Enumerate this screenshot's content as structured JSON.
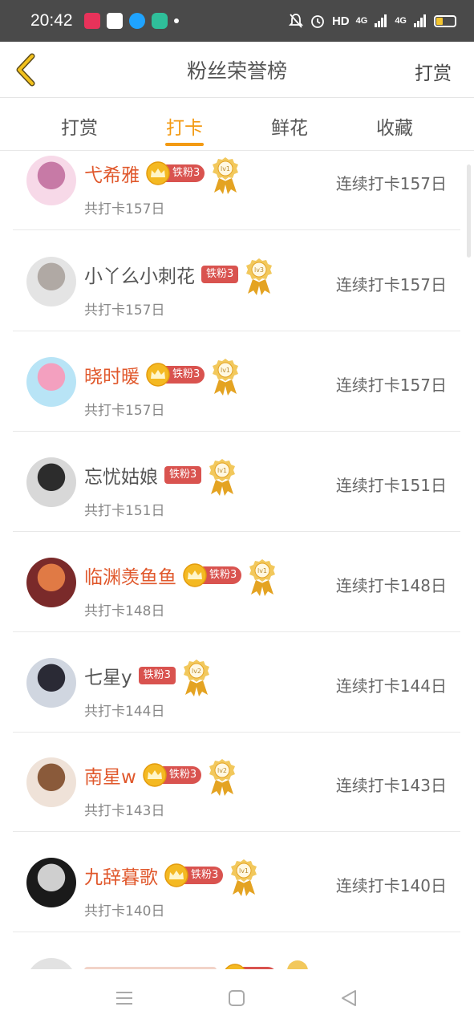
{
  "status_bar": {
    "time": "20:42",
    "network": "HD",
    "signal1": "4G",
    "signal2": "4G"
  },
  "header": {
    "title": "粉丝荣誉榜",
    "right_action": "打赏",
    "back_icon": "chevron-left-icon"
  },
  "tabs": [
    {
      "label": "打赏",
      "active": false
    },
    {
      "label": "打卡",
      "active": true
    },
    {
      "label": "鲜花",
      "active": false
    },
    {
      "label": "收藏",
      "active": false
    }
  ],
  "colors": {
    "accent": "#f39a13",
    "vip_name": "#e0582c",
    "fan_badge": "#d9534f"
  },
  "entries": [
    {
      "name": "弋希雅",
      "vip": true,
      "fan_badge": "铁粉3",
      "level": "lv1",
      "total": "共打卡157日",
      "streak": "连续打卡157日"
    },
    {
      "name": "小丫么小刺花",
      "vip": false,
      "fan_badge": "铁粉3",
      "level": "lv3",
      "total": "共打卡157日",
      "streak": "连续打卡157日"
    },
    {
      "name": "晓时暖",
      "vip": true,
      "fan_badge": "铁粉3",
      "level": "lv1",
      "total": "共打卡157日",
      "streak": "连续打卡157日"
    },
    {
      "name": "忘忧姑娘",
      "vip": false,
      "fan_badge": "铁粉3",
      "level": "lv1",
      "total": "共打卡151日",
      "streak": "连续打卡151日"
    },
    {
      "name": "临渊羡鱼鱼",
      "vip": true,
      "fan_badge": "铁粉3",
      "level": "lv1",
      "total": "共打卡148日",
      "streak": "连续打卡148日"
    },
    {
      "name": "七星y",
      "vip": false,
      "fan_badge": "铁粉3",
      "level": "lv2",
      "total": "共打卡144日",
      "streak": "连续打卡144日"
    },
    {
      "name": "南星w",
      "vip": true,
      "fan_badge": "铁粉3",
      "level": "lv2",
      "total": "共打卡143日",
      "streak": "连续打卡143日"
    },
    {
      "name": "九辞暮歌",
      "vip": true,
      "fan_badge": "铁粉3",
      "level": "lv1",
      "total": "共打卡140日",
      "streak": "连续打卡140日"
    }
  ]
}
